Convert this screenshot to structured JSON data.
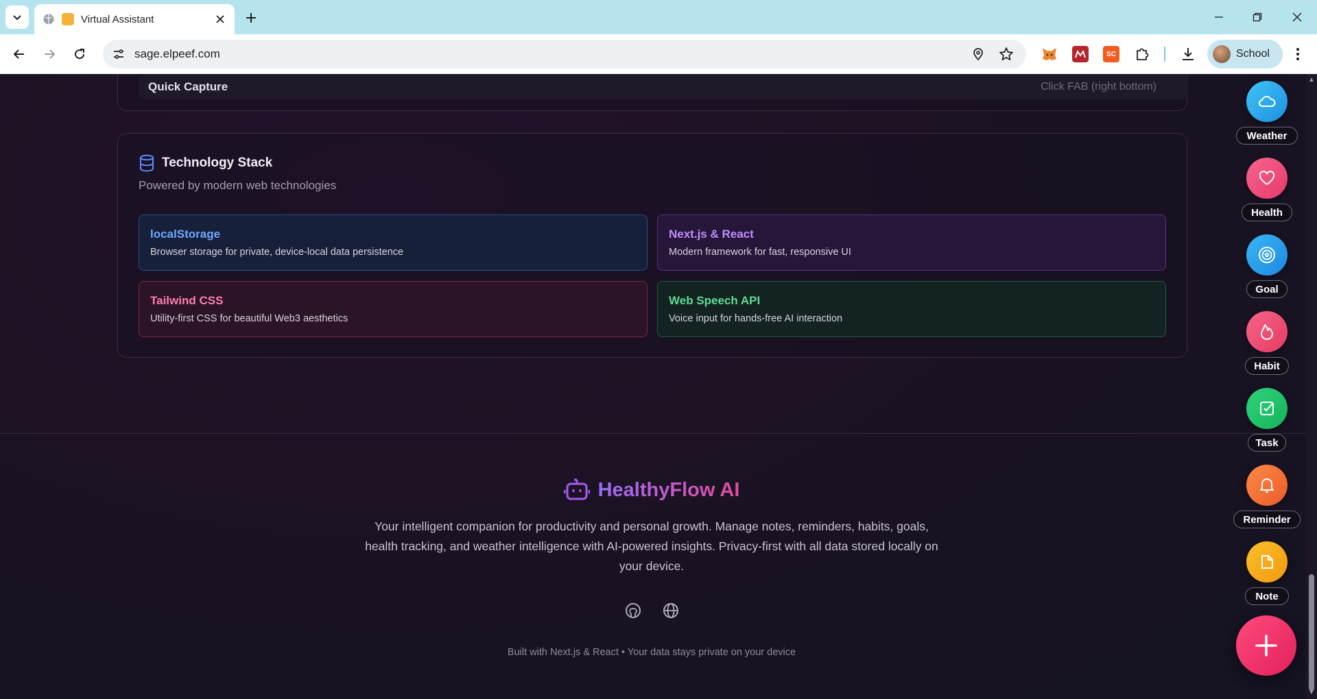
{
  "browser": {
    "tab_title": "Virtual Assistant",
    "url": "sage.elpeef.com",
    "profile_name": "School",
    "extensions": [
      "metamask-icon",
      "red-square-icon",
      "sc-icon",
      "puzzle-icon"
    ],
    "ext_sc_label": "SC"
  },
  "quick_capture": {
    "title": "Quick Capture",
    "hint": "Click FAB (right bottom)"
  },
  "tech_stack": {
    "title": "Technology Stack",
    "subtitle": "Powered by modern web technologies",
    "items": [
      {
        "name": "localStorage",
        "desc": "Browser storage for private, device-local data persistence",
        "color": "#6fa8ff"
      },
      {
        "name": "Next.js & React",
        "desc": "Modern framework for fast, responsive UI",
        "color": "#c08cff"
      },
      {
        "name": "Tailwind CSS",
        "desc": "Utility-first CSS for beautiful Web3 aesthetics",
        "color": "#ff7fb0"
      },
      {
        "name": "Web Speech API",
        "desc": "Voice input for hands-free AI interaction",
        "color": "#5fdd95"
      }
    ]
  },
  "footer": {
    "brand": "HealthyFlow AI",
    "description": "Your intelligent companion for productivity and personal growth. Manage notes, reminders, habits, goals, health tracking, and weather intelligence with AI-powered insights. Privacy-first with all data stored locally on your device.",
    "built_with": "Built with Next.js & React • Your data stays private on your device"
  },
  "fab_menu": {
    "items": [
      {
        "label": "Weather",
        "icon": "cloud-icon",
        "color": "#2eaaf0"
      },
      {
        "label": "Health",
        "icon": "heart-icon",
        "color": "#f0507a"
      },
      {
        "label": "Goal",
        "icon": "target-icon",
        "color": "#2a9ee8"
      },
      {
        "label": "Habit",
        "icon": "flame-icon",
        "color": "#ee4f72"
      },
      {
        "label": "Task",
        "icon": "checkbox-icon",
        "color": "#22c26a"
      },
      {
        "label": "Reminder",
        "icon": "bell-icon",
        "color": "#f06a34"
      },
      {
        "label": "Note",
        "icon": "note-icon",
        "color": "#f5a51c"
      }
    ],
    "main_icon": "plus-icon"
  }
}
